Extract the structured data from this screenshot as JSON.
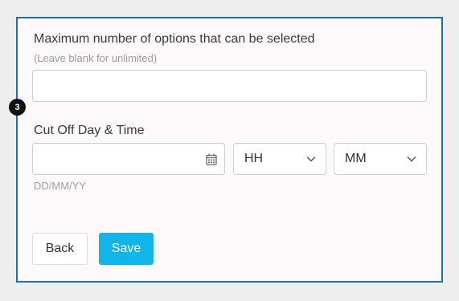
{
  "form": {
    "max_options": {
      "label": "Maximum number of options that can be selected",
      "hint": "(Leave blank for unlimited)",
      "value": ""
    },
    "cutoff": {
      "label": "Cut Off Day & Time",
      "date_value": "",
      "date_format_hint": "DD/MM/YY",
      "date_icon": "calendar-icon",
      "hour_select": "HH",
      "minute_select": "MM",
      "select_icon": "chevron-down-icon"
    }
  },
  "actions": {
    "back_label": "Back",
    "save_label": "Save"
  },
  "step_badge": {
    "number": "3"
  },
  "colors": {
    "frame_border": "#1f6fb5",
    "save_button": "#12b5e8",
    "badge": "#111111"
  }
}
